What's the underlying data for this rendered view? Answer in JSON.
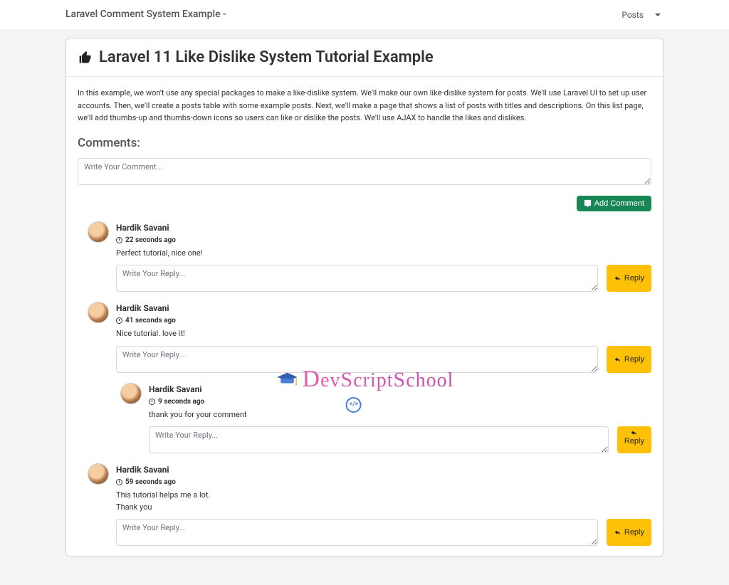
{
  "nav": {
    "brand": "Laravel Comment System Example -",
    "menu_label": "Posts"
  },
  "post": {
    "title": "Laravel 11 Like Dislike System Tutorial Example",
    "body": "In this example, we won't use any special packages to make a like-dislike system. We'll make our own like-dislike system for posts. We'll use Laravel UI to set up user accounts. Then, we'll create a posts table with some example posts. Next, we'll make a page that shows a list of posts with titles and descriptions. On this list page, we'll add thumbs-up and thumbs-down icons so users can like or dislike the posts. We'll use AJAX to handle the likes and dislikes."
  },
  "comments_section": {
    "heading": "Comments:",
    "main_placeholder": "Write Your Comment...",
    "add_button": "Add Comment",
    "reply_placeholder": "Write Your Reply...",
    "reply_button": "Reply"
  },
  "comments": [
    {
      "author": "Hardik Savani",
      "time": "22 seconds ago",
      "body": "Perfect tutorial, nice one!"
    },
    {
      "author": "Hardik Savani",
      "time": "41 seconds ago",
      "body": "Nice tutorial. love it!"
    },
    {
      "author": "Hardik Savani",
      "time": "9 seconds ago",
      "body": "thank you for your comment",
      "nested": true
    },
    {
      "author": "Hardik Savani",
      "time": "59 seconds ago",
      "body": "This tutorial helps me a lot.\nThank you"
    }
  ],
  "watermark": "DevScriptSchool"
}
